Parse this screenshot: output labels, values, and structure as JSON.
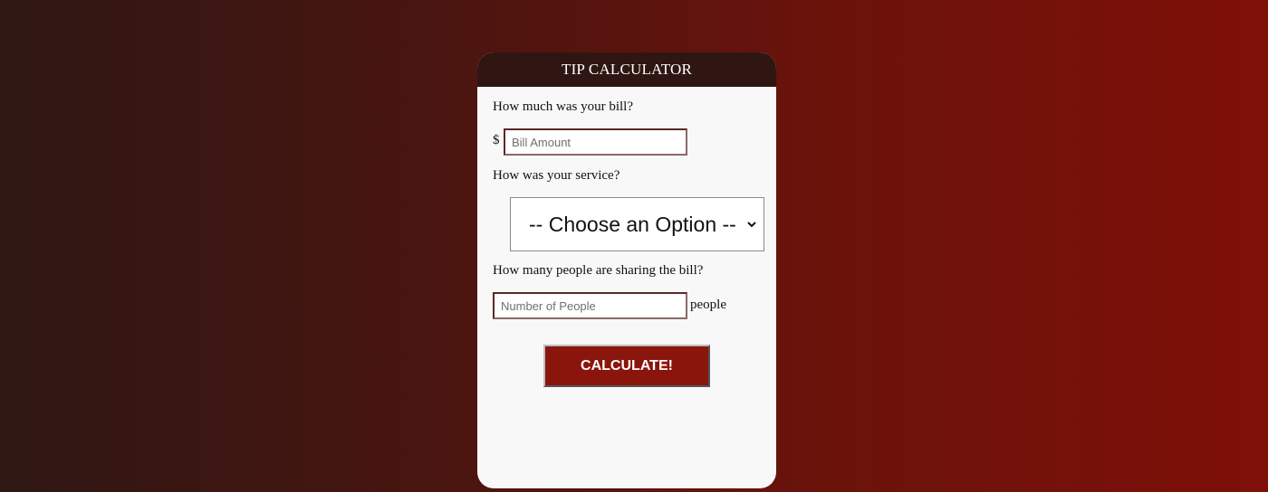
{
  "card": {
    "title": "TIP CALCULATOR"
  },
  "bill": {
    "question": "How much was your bill?",
    "currency_symbol": "$",
    "placeholder": "Bill Amount",
    "value": ""
  },
  "service": {
    "question": "How was your service?",
    "selected_option": "-- Choose an Option --",
    "icon": "chevron-down-icon"
  },
  "people": {
    "question": "How many people are sharing the bill?",
    "placeholder": "Number of People",
    "value": "",
    "suffix": "people"
  },
  "actions": {
    "calculate_label": "CALCULATE!"
  },
  "colors": {
    "header_bg": "#2f1612",
    "button_bg": "#8a150d",
    "card_bg": "#f8f8f8",
    "background_left": "#2e1714",
    "background_right": "#7e1008"
  }
}
